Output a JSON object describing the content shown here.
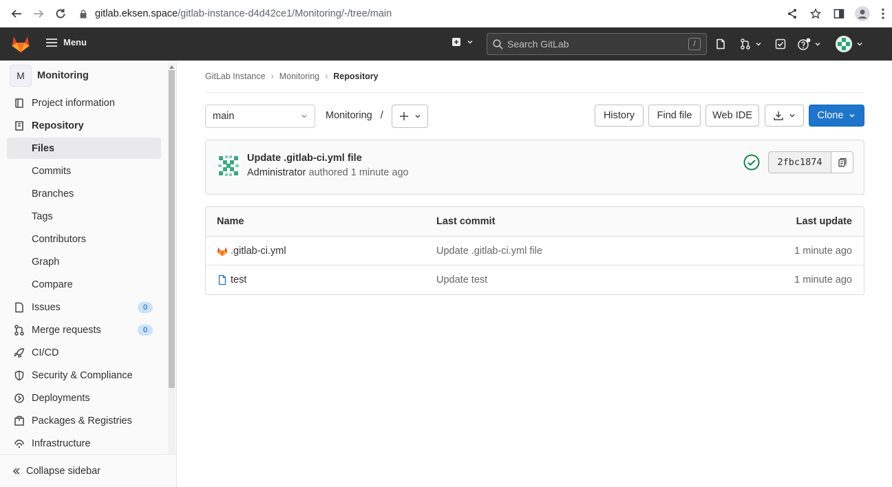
{
  "browser": {
    "url_host": "gitlab.eksen.space",
    "url_path": "/gitlab-instance-d4d42ce1/Monitoring/-/tree/main"
  },
  "topnav": {
    "menu_label": "Menu",
    "search_placeholder": "Search GitLab",
    "search_shortcut": "/"
  },
  "sidebar": {
    "project_initial": "M",
    "project_name": "Monitoring",
    "items": [
      {
        "label": "Project information",
        "icon": "project-icon"
      },
      {
        "label": "Repository",
        "icon": "repository-icon"
      },
      {
        "label": "Files"
      },
      {
        "label": "Commits"
      },
      {
        "label": "Branches"
      },
      {
        "label": "Tags"
      },
      {
        "label": "Contributors"
      },
      {
        "label": "Graph"
      },
      {
        "label": "Compare"
      },
      {
        "label": "Issues",
        "icon": "issues-icon",
        "count": "0"
      },
      {
        "label": "Merge requests",
        "icon": "merge-request-icon",
        "count": "0"
      },
      {
        "label": "CI/CD",
        "icon": "rocket-icon"
      },
      {
        "label": "Security & Compliance",
        "icon": "shield-icon"
      },
      {
        "label": "Deployments",
        "icon": "deployments-icon"
      },
      {
        "label": "Packages & Registries",
        "icon": "package-icon"
      },
      {
        "label": "Infrastructure",
        "icon": "cloud-icon"
      }
    ],
    "collapse_label": "Collapse sidebar"
  },
  "breadcrumb": {
    "items": [
      "GitLab Instance",
      "Monitoring",
      "Repository"
    ]
  },
  "repo": {
    "branch": "main",
    "path_root": "Monitoring",
    "path_sep": "/",
    "buttons": {
      "history": "History",
      "find_file": "Find file",
      "web_ide": "Web IDE",
      "clone": "Clone"
    }
  },
  "last_commit": {
    "title": "Update .gitlab-ci.yml file",
    "author": "Administrator",
    "action": "authored",
    "time": "1 minute ago",
    "sha": "2fbc1874",
    "status_color": "#108548"
  },
  "tree": {
    "headers": {
      "name": "Name",
      "last_commit": "Last commit",
      "last_update": "Last update"
    },
    "rows": [
      {
        "name": ".gitlab-ci.yml",
        "icon": "gitlab-ci-icon",
        "commit": "Update .gitlab-ci.yml file",
        "updated": "1 minute ago"
      },
      {
        "name": "test",
        "icon": "file-icon",
        "commit": "Update test",
        "updated": "1 minute ago"
      }
    ]
  },
  "colors": {
    "topnav_bg": "#2e2e2e",
    "primary": "#1f75cb",
    "badge_bg": "#cbe2f9"
  }
}
